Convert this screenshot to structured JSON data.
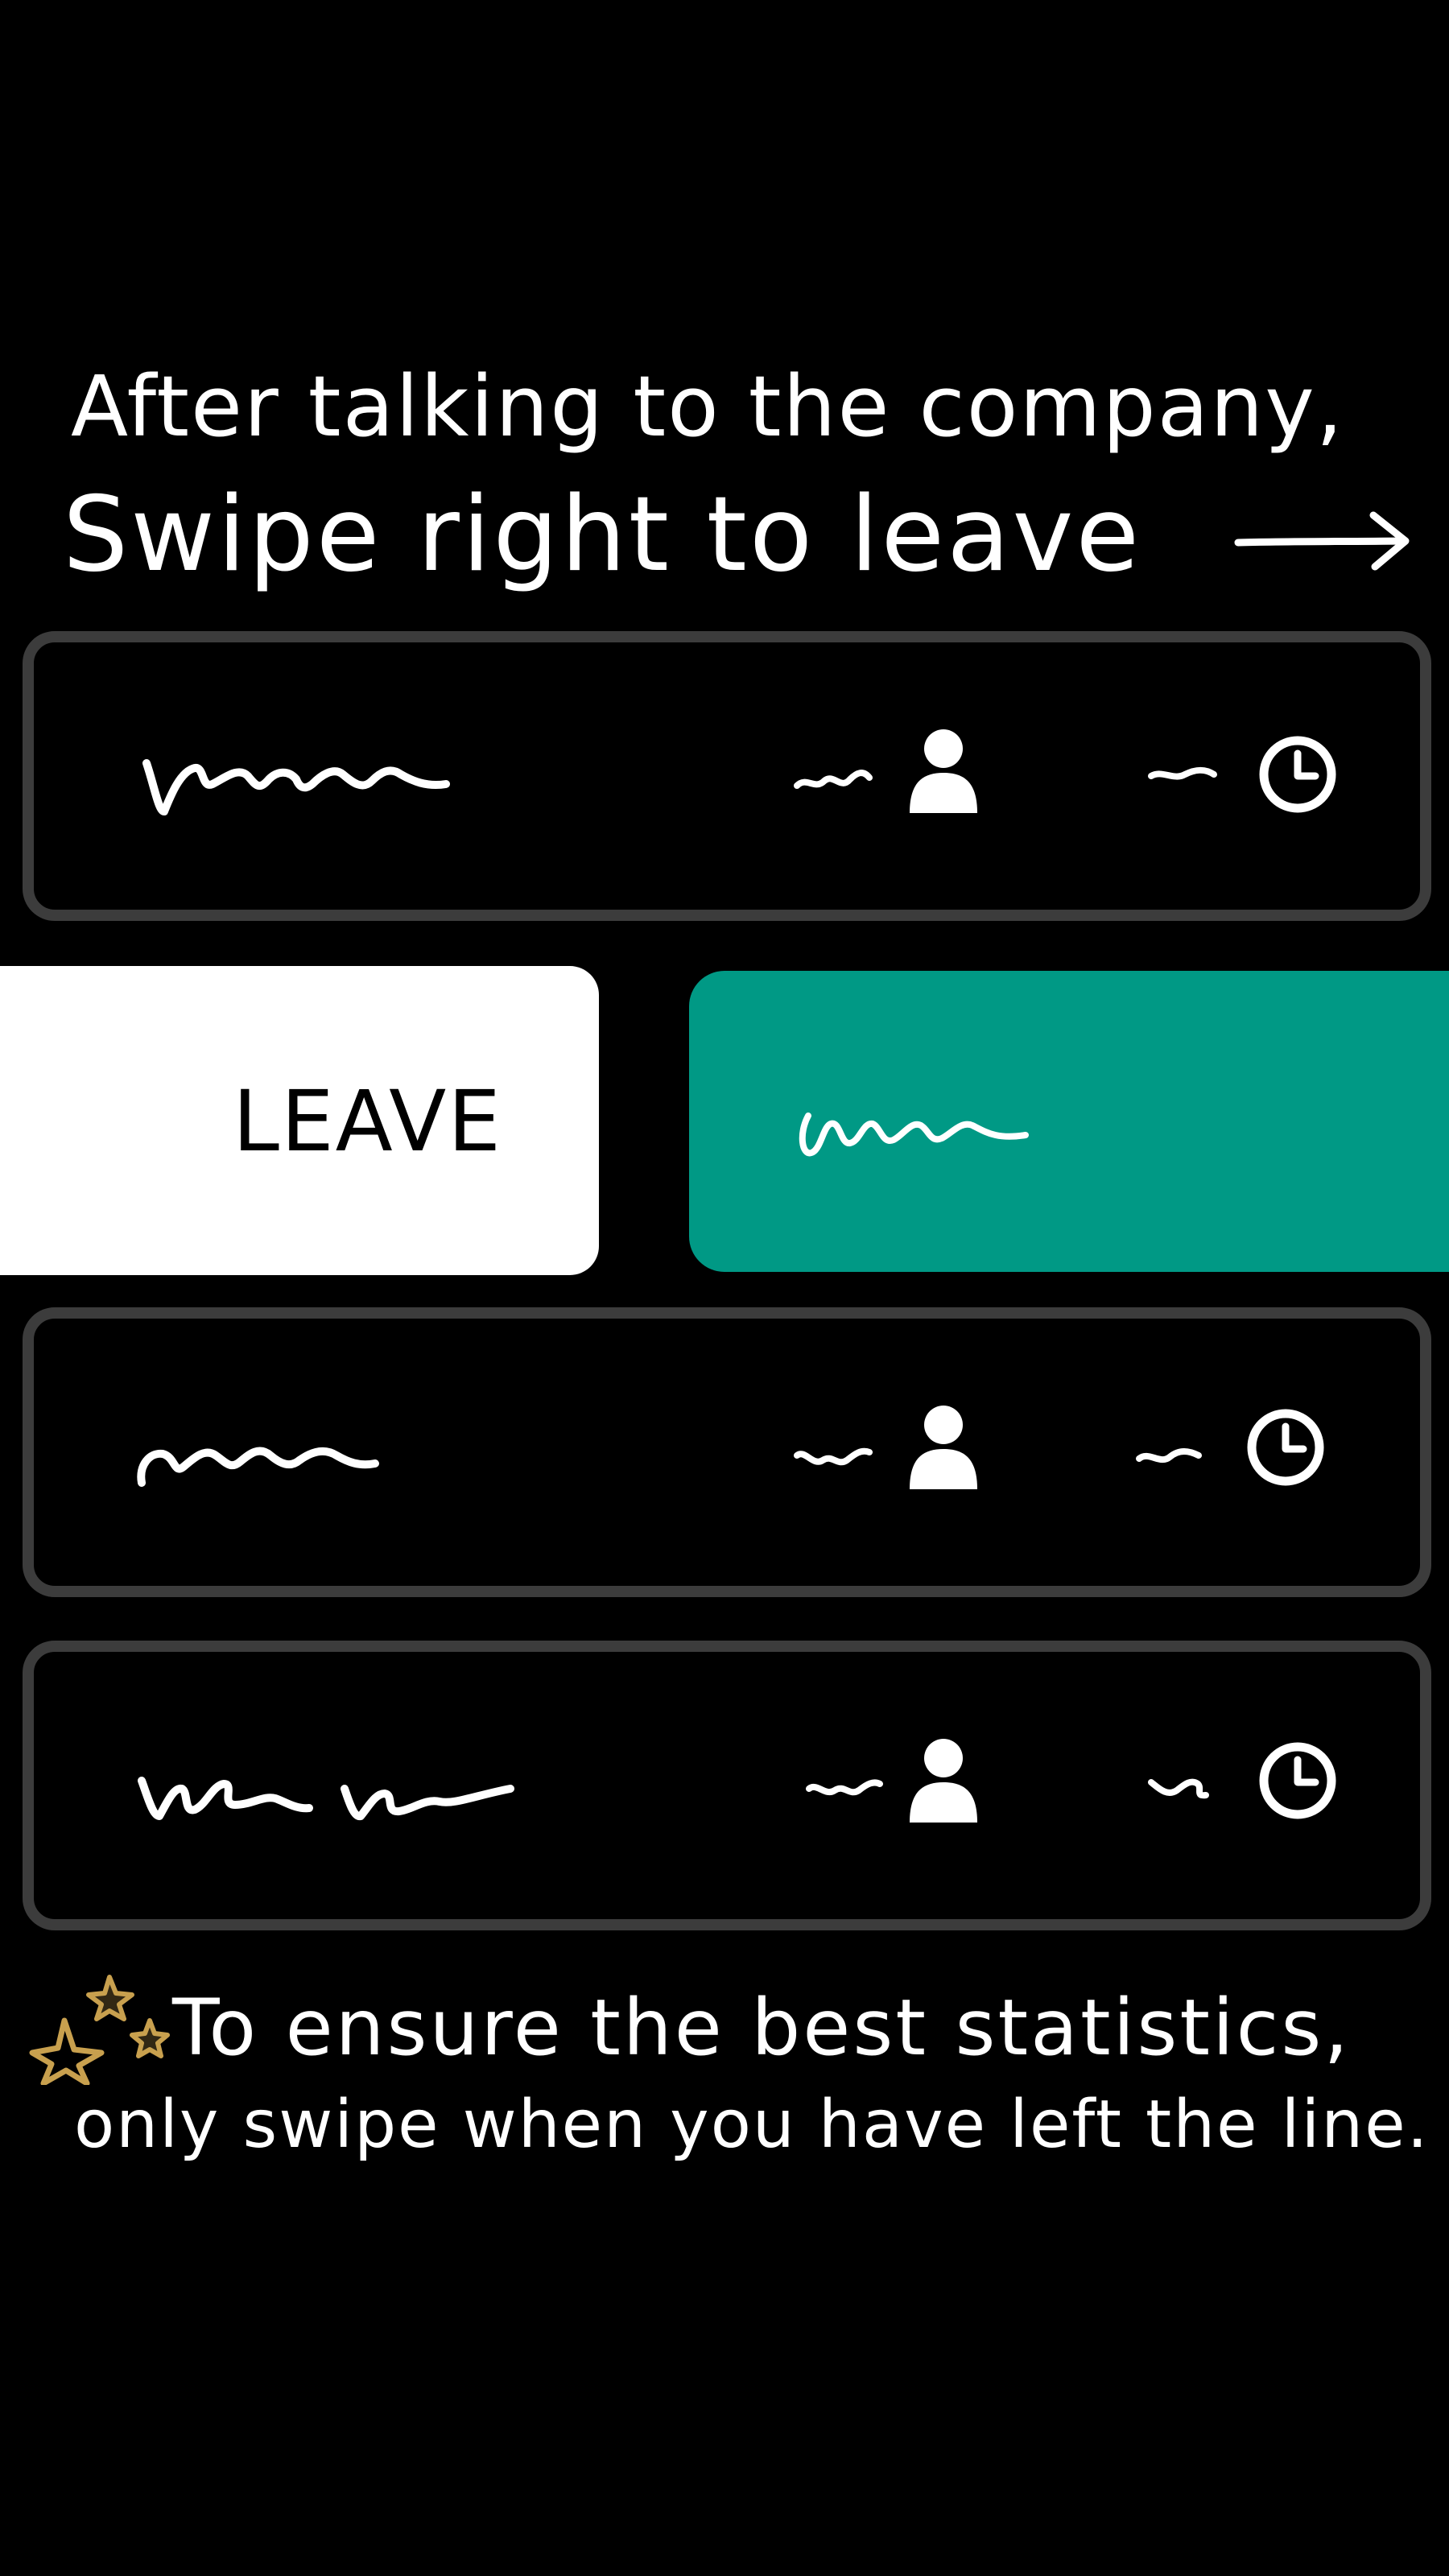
{
  "instructions": {
    "line_1": "After talking to the company,",
    "line_2": "Swipe right to leave"
  },
  "rows": [
    {
      "state": "idle",
      "name_scribble": "placeholder",
      "people_icon": "person-icon",
      "time_icon": "clock-icon"
    },
    {
      "state": "swiped-right",
      "action_label": "LEAVE",
      "name_scribble": "placeholder"
    },
    {
      "state": "idle",
      "name_scribble": "placeholder",
      "people_icon": "person-icon",
      "time_icon": "clock-icon"
    },
    {
      "state": "idle",
      "name_scribble": "placeholder",
      "people_icon": "person-icon",
      "time_icon": "clock-icon"
    }
  ],
  "swipe_action": {
    "label": "LEAVE"
  },
  "footer": {
    "line_1": "To ensure the best statistics,",
    "line_2": "only swipe when you have left the line."
  },
  "colors": {
    "background": "#000000",
    "row_border": "#3c3c3c",
    "swiped_row": "#009985",
    "action_background": "#ffffff",
    "stars": "#c8a04e",
    "text": "#ffffff"
  }
}
